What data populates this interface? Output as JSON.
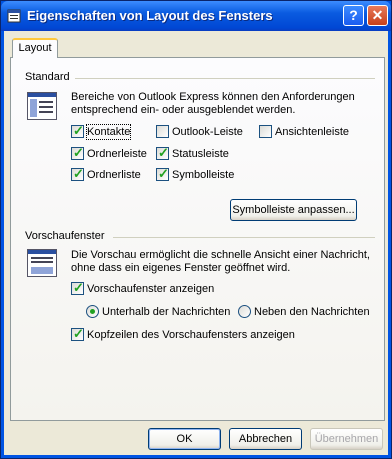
{
  "window": {
    "title": "Eigenschaften von Layout des Fensters",
    "help_button": "?",
    "close_button": "✕"
  },
  "tabs": [
    {
      "label": "Layout",
      "selected": true
    }
  ],
  "standard": {
    "group_label": "Standard",
    "description": "Bereiche von Outlook Express können den Anforderungen entsprechend ein- oder ausgeblendet werden.",
    "checkboxes": [
      {
        "label": "Kontakte",
        "checked": true
      },
      {
        "label": "Outlook-Leiste",
        "checked": false
      },
      {
        "label": "Ansichtenleiste",
        "checked": false
      },
      {
        "label": "Ordnerleiste",
        "checked": true
      },
      {
        "label": "Statusleiste",
        "checked": true
      },
      {
        "label": "Ordnerliste",
        "checked": true
      },
      {
        "label": "Symbolleiste",
        "checked": true
      }
    ],
    "customize_button": "Symbolleiste anpassen..."
  },
  "preview": {
    "group_label": "Vorschaufenster",
    "description": "Die Vorschau ermöglicht die schnelle Ansicht einer Nachricht, ohne dass ein eigenes Fenster geöffnet wird.",
    "show_preview": {
      "label": "Vorschaufenster anzeigen",
      "checked": true
    },
    "radios": [
      {
        "label": "Unterhalb der Nachrichten",
        "selected": true
      },
      {
        "label": "Neben den Nachrichten",
        "selected": false
      }
    ],
    "show_headers": {
      "label": "Kopfzeilen des Vorschaufensters anzeigen",
      "checked": true
    }
  },
  "buttons": {
    "ok": "OK",
    "cancel": "Abbrechen",
    "apply": "Übernehmen"
  },
  "colors": {
    "titlebar": "#0054e3",
    "dialog_bg": "#ece9d8",
    "check": "#21a121"
  }
}
